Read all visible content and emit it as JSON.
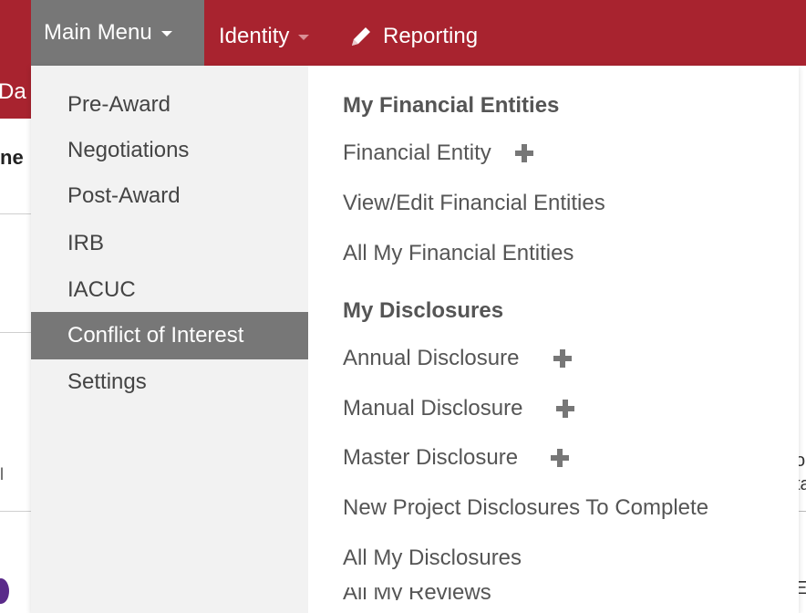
{
  "topbar": {
    "main_menu": "Main Menu",
    "identity": "Identity",
    "reporting": "Reporting"
  },
  "background": {
    "tab_fragment": "Da",
    "heading_fragment": "ne",
    "right_fragment_1": "o",
    "right_fragment_2": "ta",
    "right_fragment_3": "E",
    "left_fragment": "l"
  },
  "left_menu": [
    {
      "label": "Pre-Award",
      "active": false
    },
    {
      "label": "Negotiations",
      "active": false
    },
    {
      "label": "Post-Award",
      "active": false
    },
    {
      "label": "IRB",
      "active": false
    },
    {
      "label": "IACUC",
      "active": false
    },
    {
      "label": "Conflict of Interest",
      "active": true
    },
    {
      "label": "Settings",
      "active": false
    }
  ],
  "right_menu": {
    "financial_header": "My Financial Entities",
    "financial_entity": "Financial Entity",
    "view_edit": "View/Edit Financial Entities",
    "all_financial": "All My Financial Entities",
    "disclosures_header": "My Disclosures",
    "annual": "Annual Disclosure",
    "manual": "Manual Disclosure",
    "master": "Master Disclosure",
    "new_project": "New Project Disclosures To Complete",
    "all_disclosures": "All My Disclosures",
    "cutoff_item": "All My Reviews"
  },
  "colors": {
    "brand": "#a8232f",
    "menu_active": "#777777"
  },
  "icons": [
    "caret-down-icon",
    "pencil-icon",
    "plus-icon"
  ]
}
